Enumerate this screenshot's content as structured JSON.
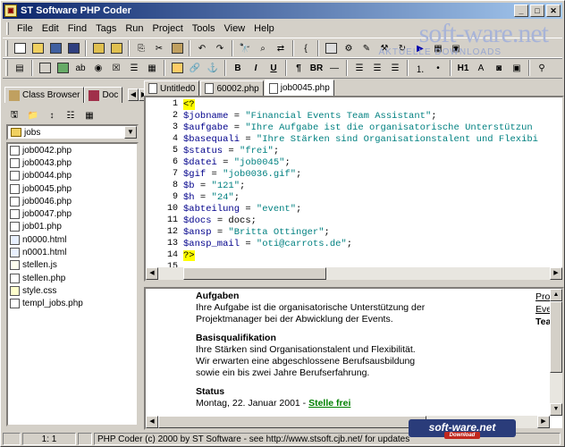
{
  "window": {
    "title": "ST Software PHP Coder"
  },
  "menu": [
    "File",
    "Edit",
    "Find",
    "Tags",
    "Run",
    "Project",
    "Tools",
    "View",
    "Help"
  ],
  "watermark": {
    "main": "soft-ware.net",
    "sub": "AKTUELLE DOWNLOADS",
    "badge": "soft-ware.net",
    "badge_sub": "Download"
  },
  "toolbar2_text": {
    "bold": "B",
    "italic": "I",
    "underline": "U",
    "para": "¶",
    "br": "BR",
    "h1": "H1"
  },
  "left_tabs": [
    "Class Browser",
    "Doc"
  ],
  "folder": "jobs",
  "files": [
    {
      "name": "job0042.php",
      "type": "php"
    },
    {
      "name": "job0043.php",
      "type": "php"
    },
    {
      "name": "job0044.php",
      "type": "php"
    },
    {
      "name": "job0045.php",
      "type": "php"
    },
    {
      "name": "job0046.php",
      "type": "php"
    },
    {
      "name": "job0047.php",
      "type": "php"
    },
    {
      "name": "job01.php",
      "type": "php"
    },
    {
      "name": "n0000.html",
      "type": "html"
    },
    {
      "name": "n0001.html",
      "type": "html"
    },
    {
      "name": "stellen.js",
      "type": "js"
    },
    {
      "name": "stellen.php",
      "type": "php"
    },
    {
      "name": "style.css",
      "type": "css"
    },
    {
      "name": "templ_jobs.php",
      "type": "php"
    }
  ],
  "editor_tabs": [
    "Untitled0",
    "60002.php",
    "job0045.php"
  ],
  "active_tab": "job0045.php",
  "code_lines": [
    {
      "n": "1",
      "parts": [
        {
          "t": "<?",
          "c": "tag"
        }
      ]
    },
    {
      "n": "2",
      "parts": [
        {
          "t": "$jobname",
          "c": "var"
        },
        {
          "t": " = ",
          "c": "op"
        },
        {
          "t": "\"Financial Events Team Assistant\"",
          "c": "str"
        },
        {
          "t": ";",
          "c": "op"
        }
      ]
    },
    {
      "n": "3",
      "parts": [
        {
          "t": "$aufgabe",
          "c": "var"
        },
        {
          "t": " = ",
          "c": "op"
        },
        {
          "t": "\"Ihre Aufgabe ist die organisatorische Unterstützun",
          "c": "str"
        }
      ]
    },
    {
      "n": "4",
      "parts": [
        {
          "t": "$basequali",
          "c": "var"
        },
        {
          "t": " = ",
          "c": "op"
        },
        {
          "t": "\"Ihre Stärken sind Organisationstalent und Flexibi",
          "c": "str"
        }
      ]
    },
    {
      "n": "5",
      "parts": [
        {
          "t": "$status",
          "c": "var"
        },
        {
          "t": " = ",
          "c": "op"
        },
        {
          "t": "\"frei\"",
          "c": "str"
        },
        {
          "t": ";",
          "c": "op"
        }
      ]
    },
    {
      "n": "6",
      "parts": [
        {
          "t": "$datei",
          "c": "var"
        },
        {
          "t": " = ",
          "c": "op"
        },
        {
          "t": "\"job0045\"",
          "c": "str"
        },
        {
          "t": ";",
          "c": "op"
        }
      ]
    },
    {
      "n": "7",
      "parts": [
        {
          "t": "$gif",
          "c": "var"
        },
        {
          "t": " = ",
          "c": "op"
        },
        {
          "t": "\"job0036.gif\"",
          "c": "str"
        },
        {
          "t": ";",
          "c": "op"
        }
      ]
    },
    {
      "n": "8",
      "parts": [
        {
          "t": "$b",
          "c": "var"
        },
        {
          "t": " = ",
          "c": "op"
        },
        {
          "t": "\"121\"",
          "c": "str"
        },
        {
          "t": ";",
          "c": "op"
        }
      ]
    },
    {
      "n": "9",
      "parts": [
        {
          "t": "$h",
          "c": "var"
        },
        {
          "t": " = ",
          "c": "op"
        },
        {
          "t": "\"24\"",
          "c": "str"
        },
        {
          "t": ";",
          "c": "op"
        }
      ]
    },
    {
      "n": "10",
      "parts": [
        {
          "t": "$abteilung",
          "c": "var"
        },
        {
          "t": " = ",
          "c": "op"
        },
        {
          "t": "\"event\"",
          "c": "str"
        },
        {
          "t": ";",
          "c": "op"
        }
      ]
    },
    {
      "n": "11",
      "parts": [
        {
          "t": "$docs",
          "c": "var"
        },
        {
          "t": " = docs;",
          "c": "op"
        }
      ]
    },
    {
      "n": "12",
      "parts": [
        {
          "t": "$ansp",
          "c": "var"
        },
        {
          "t": " = ",
          "c": "op"
        },
        {
          "t": "\"Britta Ottinger\"",
          "c": "str"
        },
        {
          "t": ";",
          "c": "op"
        }
      ]
    },
    {
      "n": "13",
      "parts": [
        {
          "t": "$ansp_mail",
          "c": "var"
        },
        {
          "t": " = ",
          "c": "op"
        },
        {
          "t": "\"oti@carrots.de\"",
          "c": "str"
        },
        {
          "t": ";",
          "c": "op"
        }
      ]
    },
    {
      "n": "14",
      "parts": [
        {
          "t": "?>",
          "c": "tag"
        }
      ]
    },
    {
      "n": "15",
      "parts": []
    }
  ],
  "preview": {
    "h_aufgaben": "Aufgaben",
    "aufgaben_1": "Ihre Aufgabe ist die organisatorische Unterstützung der",
    "aufgaben_2": "Projektmanager bei der Abwicklung der Events.",
    "h_basis": "Basisqualifikation",
    "basis_1": "Ihre Stärken sind Organisationstalent und Flexibilität.",
    "basis_2": "Wir erwarten eine abgeschlossene Berufsausbildung",
    "basis_3": "sowie ein bis zwei Jahre Berufserfahrung.",
    "h_status": "Status",
    "status_date": "Montag, 22. Januar 2001 - ",
    "status_link": "Stelle frei",
    "side_1": "Pro",
    "side_2": "Eve",
    "side_3": "Tea"
  },
  "status": {
    "pos": "1: 1",
    "text": "PHP Coder (c) 2000 by ST Software - see http://www.stsoft.cjb.net/ for updates"
  }
}
